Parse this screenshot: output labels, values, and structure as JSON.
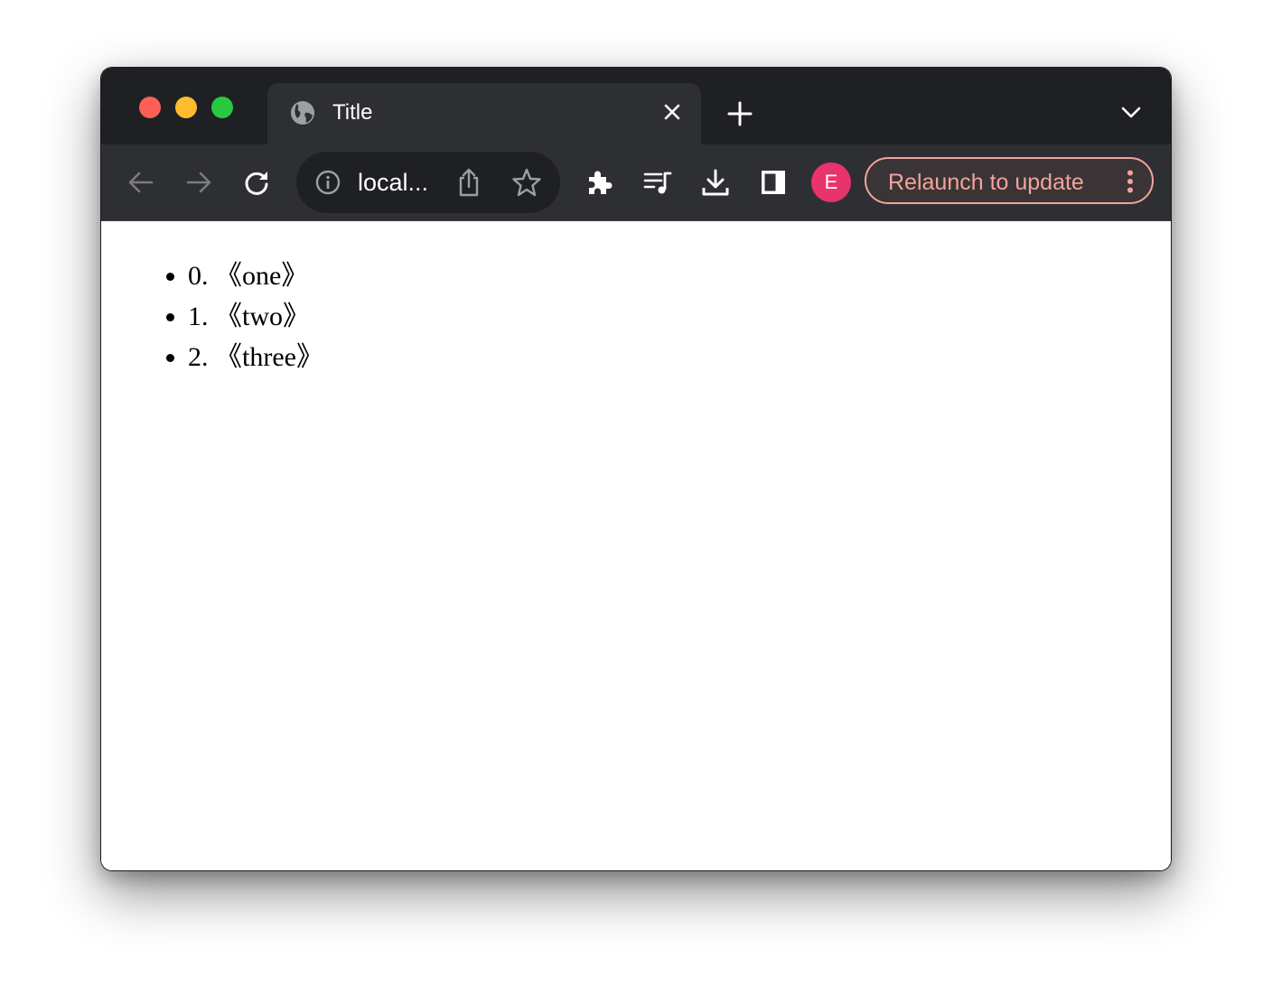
{
  "window": {
    "traffic_lights": [
      {
        "name": "close",
        "color": "#fe5f57"
      },
      {
        "name": "minimize",
        "color": "#febc2e"
      },
      {
        "name": "zoom",
        "color": "#28c840"
      }
    ]
  },
  "tabs": [
    {
      "title": "Title",
      "icon": "globe-icon",
      "active": true
    }
  ],
  "tabstrip": {
    "new_tab_icon": "plus-icon",
    "tab_search_icon": "chevron-down-icon"
  },
  "toolbar": {
    "back_icon": "arrow-left-icon",
    "forward_icon": "arrow-right-icon",
    "reload_icon": "reload-icon",
    "omnibox": {
      "site_info_icon": "info-icon",
      "url": "local...",
      "share_icon": "share-icon",
      "bookmark_icon": "star-icon"
    },
    "extensions_icon": "puzzle-icon",
    "media_icon": "playlist-music-icon",
    "downloads_icon": "download-icon",
    "side_panel_icon": "side-panel-icon",
    "profile_initial": "E",
    "relaunch_label": "Relaunch to update",
    "menu_icon": "kebab-menu-icon"
  },
  "colors": {
    "tabstrip_bg": "#1f2023",
    "toolbar_bg": "#2e2f33",
    "avatar_bg": "#e8336c",
    "relaunch_accent": "#f2a39b"
  },
  "page": {
    "list_items": [
      "0. 《one》",
      "1. 《two》",
      "2. 《three》"
    ]
  }
}
